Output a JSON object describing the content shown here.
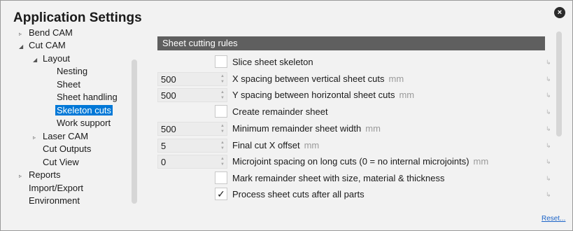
{
  "dialog": {
    "title": "Application Settings",
    "close_icon": "×",
    "reset_link": "Reset..."
  },
  "tree": {
    "items": [
      {
        "label": "Bend CAM",
        "arrow": "▹"
      },
      {
        "label": "Cut CAM",
        "arrow": "◢"
      },
      {
        "label": "Layout",
        "arrow": "◢"
      },
      {
        "label": "Nesting",
        "arrow": ""
      },
      {
        "label": "Sheet",
        "arrow": ""
      },
      {
        "label": "Sheet handling",
        "arrow": ""
      },
      {
        "label": "Skeleton cuts",
        "arrow": ""
      },
      {
        "label": "Work support",
        "arrow": ""
      },
      {
        "label": "Laser CAM",
        "arrow": "▹"
      },
      {
        "label": "Cut Outputs",
        "arrow": ""
      },
      {
        "label": "Cut View",
        "arrow": ""
      },
      {
        "label": "Reports",
        "arrow": "▹"
      },
      {
        "label": "Import/Export",
        "arrow": ""
      },
      {
        "label": "Environment",
        "arrow": ""
      }
    ],
    "selected": "Skeleton cuts"
  },
  "section": {
    "header": "Sheet cutting rules",
    "rows": [
      {
        "type": "checkbox",
        "checked": false,
        "label": "Slice sheet skeleton",
        "unit": ""
      },
      {
        "type": "spin",
        "value": "500",
        "label": "X spacing between vertical sheet cuts",
        "unit": "mm"
      },
      {
        "type": "spin",
        "value": "500",
        "label": "Y spacing between horizontal sheet cuts",
        "unit": "mm"
      },
      {
        "type": "checkbox",
        "checked": false,
        "label": "Create remainder sheet",
        "unit": ""
      },
      {
        "type": "spin",
        "value": "500",
        "label": "Minimum remainder sheet width",
        "unit": "mm"
      },
      {
        "type": "spin",
        "value": "5",
        "label": "Final cut X offset",
        "unit": "mm"
      },
      {
        "type": "spin",
        "value": "0",
        "label": "Microjoint spacing on long cuts (0 = no internal microjoints)",
        "unit": "mm"
      },
      {
        "type": "checkbox",
        "checked": false,
        "label": "Mark remainder sheet with size, material & thickness",
        "unit": ""
      },
      {
        "type": "checkbox",
        "checked": true,
        "label": "Process sheet cuts after all parts",
        "unit": ""
      }
    ],
    "checkmark": "✓",
    "reset_marker": "↳"
  }
}
